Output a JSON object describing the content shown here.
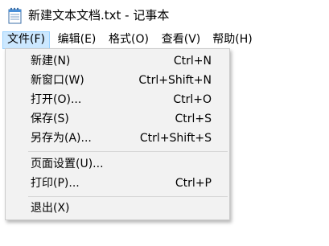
{
  "window": {
    "title": "新建文本文档.txt - 记事本",
    "icon": "notepad-icon"
  },
  "menubar": {
    "items": [
      {
        "label": "文件(F)",
        "active": true
      },
      {
        "label": "编辑(E)",
        "active": false
      },
      {
        "label": "格式(O)",
        "active": false
      },
      {
        "label": "查看(V)",
        "active": false
      },
      {
        "label": "帮助(H)",
        "active": false
      }
    ]
  },
  "file_menu": {
    "items": [
      {
        "label": "新建(N)",
        "shortcut": "Ctrl+N"
      },
      {
        "label": "新窗口(W)",
        "shortcut": "Ctrl+Shift+N"
      },
      {
        "label": "打开(O)...",
        "shortcut": "Ctrl+O"
      },
      {
        "label": "保存(S)",
        "shortcut": "Ctrl+S"
      },
      {
        "label": "另存为(A)...",
        "shortcut": "Ctrl+Shift+S"
      },
      {
        "label": "页面设置(U)...",
        "shortcut": ""
      },
      {
        "label": "打印(P)...",
        "shortcut": "Ctrl+P"
      },
      {
        "label": "退出(X)",
        "shortcut": ""
      }
    ]
  },
  "colors": {
    "menu_active_bg": "#cce8ff",
    "menu_active_border": "#99d1ff",
    "dropdown_bg": "#f2f2f2",
    "separator": "#d7d7d7"
  }
}
